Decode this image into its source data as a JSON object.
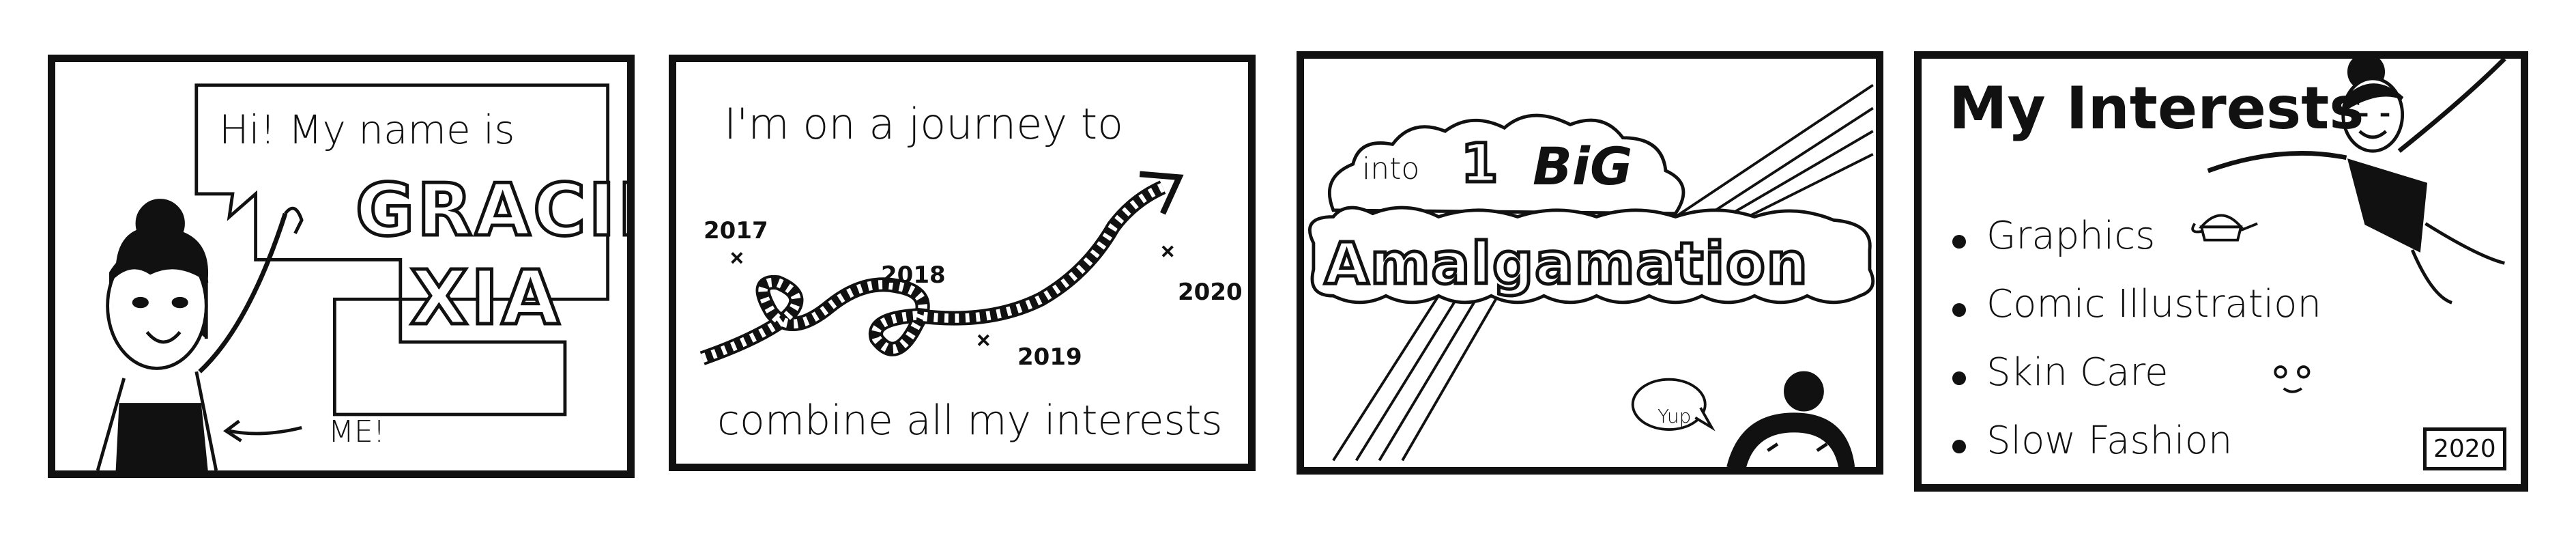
{
  "panel1": {
    "speech": "Hi! My name is",
    "name_line1": "GRACIE",
    "name_line2": "XIA",
    "pointer_label": "ME!"
  },
  "panel2": {
    "caption_top": "I'm on a journey to",
    "caption_bottom": "combine all my interests",
    "years": [
      "2017",
      "2018",
      "2019",
      "2020"
    ]
  },
  "panel3": {
    "into": "into",
    "one": "1",
    "big": "BiG",
    "amalgamation": "Amalgamation",
    "yup": "Yup."
  },
  "panel4": {
    "title": "My Interests",
    "interests": [
      "Graphics",
      "Comic Illustration",
      "Skin Care",
      "Slow Fashion"
    ],
    "year_badge": "2020"
  }
}
